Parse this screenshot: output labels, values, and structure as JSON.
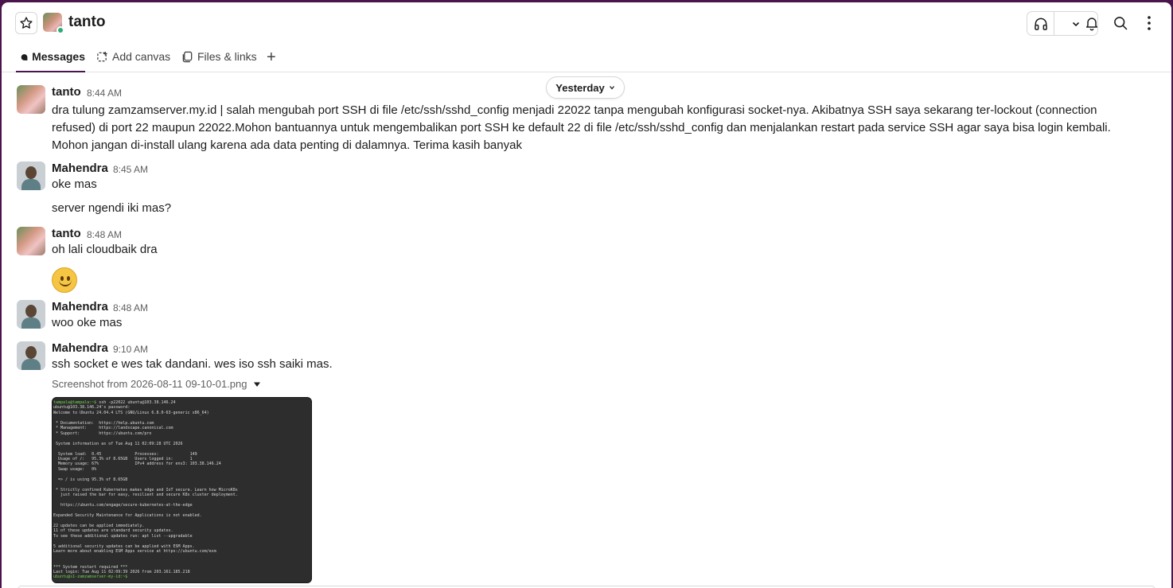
{
  "channel": {
    "name": "tanto"
  },
  "tabs": [
    {
      "label": "Messages"
    },
    {
      "label": "Add canvas"
    },
    {
      "label": "Files & links"
    }
  ],
  "day_divider": {
    "label": "Yesterday"
  },
  "messages": [
    {
      "user": "tanto",
      "time": "8:44 AM",
      "text": "dra tulung zamzamserver.my.id | salah mengubah port SSH di file /etc/ssh/sshd_config menjadi 22022 tanpa mengubah konfigurasi socket-nya. Akibatnya SSH saya sekarang ter-lockout (connection refused) di port 22 maupun 22022.Mohon bantuannya untuk mengembalikan port SSH ke default 22 di file /etc/ssh/sshd_config dan menjalankan restart pada service SSH agar saya bisa login kembali. Mohon jangan di-install ulang karena ada data penting di dalamnya. Terima kasih banyak"
    },
    {
      "user": "Mahendra",
      "time": "8:45 AM",
      "text": "oke mas",
      "followup": "server ngendi iki mas?"
    },
    {
      "user": "tanto",
      "time": "8:48 AM",
      "text": "oh lali cloudbaik dra"
    },
    {
      "user": "Mahendra",
      "time": "8:48 AM",
      "text": "woo oke mas"
    },
    {
      "user": "Mahendra",
      "time": "9:10 AM",
      "text": "ssh socket e wes tak dandani. wes iso ssh saiki mas."
    }
  ],
  "attachment": {
    "filename": "Screenshot from 2026-08-11 09-10-01.png",
    "terminal_lines": [
      "tampala@tampala:~$ ssh -p22022 ubuntu@103.38.146.24",
      "ubuntu@103.38.146.24's password:",
      "Welcome to Ubuntu 24.04.4 LTS (GNU/Linux 6.8.0-63-generic x86_64)",
      "",
      " * Documentation:  https://help.ubuntu.com",
      " * Management:     https://landscape.canonical.com",
      " * Support:        https://ubuntu.com/pro",
      "",
      " System information as of Tue Aug 11 02:09:28 UTC 2026",
      "",
      "  System load:  0.45              Processes:             149",
      "  Usage of /:   95.3% of 8.65GB   Users logged in:       1",
      "  Memory usage: 67%               IPv4 address for ens3: 103.38.146.24",
      "  Swap usage:   0%",
      "",
      "  => / is using 95.3% of 8.65GB",
      "",
      " * Strictly confined Kubernetes makes edge and IoT secure. Learn how MicroK8s",
      "   just raised the bar for easy, resilient and secure K8s cluster deployment.",
      "",
      "   https://ubuntu.com/engage/secure-kubernetes-at-the-edge",
      "",
      "Expanded Security Maintenance for Applications is not enabled.",
      "",
      "22 updates can be applied immediately.",
      "11 of these updates are standard security updates.",
      "To see these additional updates run: apt list --upgradable",
      "",
      "5 additional security updates can be applied with ESM Apps.",
      "Learn more about enabling ESM Apps service at https://ubuntu.com/esm",
      "",
      "",
      "*** System restart required ***",
      "Last login: Tue Aug 11 02:09:39 2026 from 203.161.185.218",
      "ubuntu@s1-zamzamserver-my-id:~$ "
    ]
  },
  "colors": {
    "aubergine": "#4a154b",
    "presence": "#2bac76",
    "terminal_bg": "#2d2d2d",
    "prompt_green": "#6fd34b"
  }
}
